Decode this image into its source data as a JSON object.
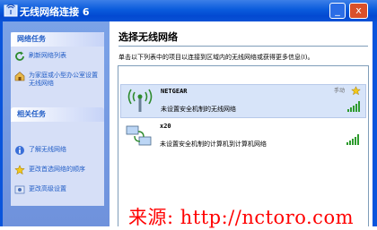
{
  "window": {
    "title": "无线网络连接 6",
    "minimize_symbol": "_",
    "close_symbol": "x"
  },
  "sidebar": {
    "network_tasks": {
      "heading": "网络任务",
      "items": [
        {
          "label": "刷新网络列表",
          "icon": "refresh-icon"
        },
        {
          "label": "为家庭或小型办公室设置无线网络",
          "icon": "home-network-icon"
        }
      ]
    },
    "related_tasks": {
      "heading": "相关任务",
      "items": [
        {
          "label": "了解无线网络",
          "icon": "info-icon"
        },
        {
          "label": "更改首选网络的顺序",
          "icon": "star-icon"
        },
        {
          "label": "更改高级设置",
          "icon": "settings-icon"
        }
      ]
    }
  },
  "main": {
    "title": "选择无线网络",
    "description": "单击以下列表中的项目以连接到区域内的无线网络或获得更多信息(I)。",
    "networks": [
      {
        "name": "NETGEAR",
        "mode": "手动",
        "status": "未设置安全机制的无线网络",
        "signal_bars": 5,
        "preferred": true
      },
      {
        "name": "x20",
        "status": "未设置安全机制的计算机到计算机网络",
        "signal_bars": 5
      }
    ]
  },
  "watermark": "来源: http://nctoro.com",
  "colors": {
    "titlebar": "#0a5bdc",
    "sidebar": "#6f92dc",
    "link": "#215dc6",
    "selection": "#d7e4f9",
    "watermark": "#ff0000"
  }
}
